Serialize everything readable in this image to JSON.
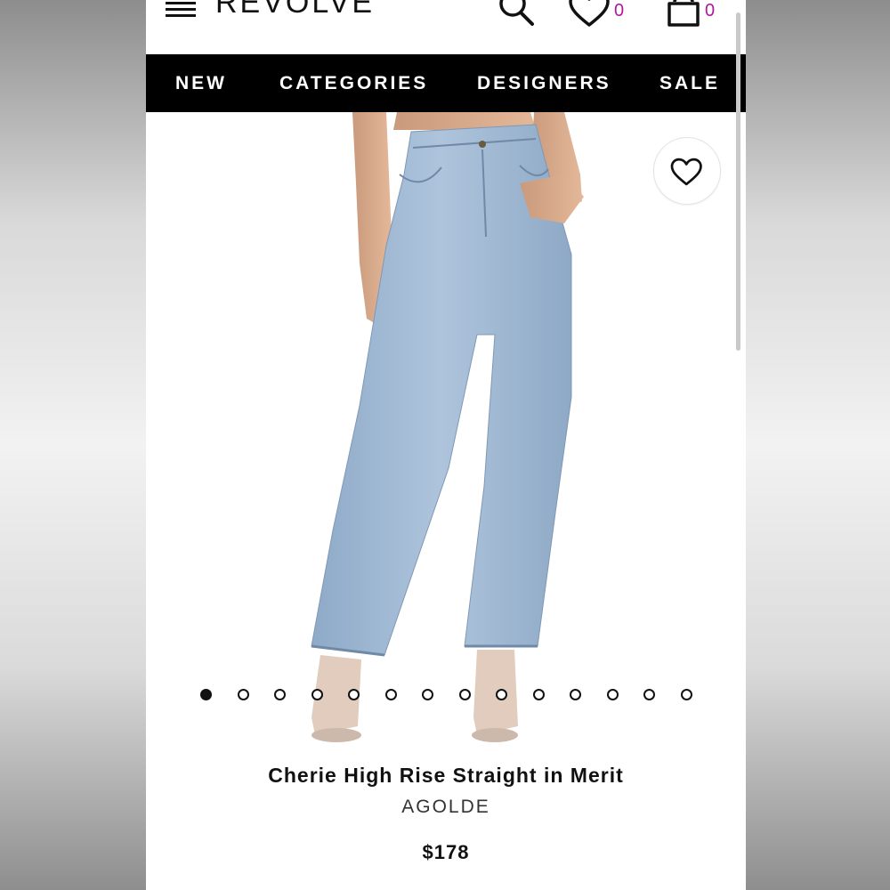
{
  "header": {
    "logo": "REVOLVE",
    "wishlist_count": "0",
    "bag_count": "0"
  },
  "nav": {
    "items": [
      "NEW",
      "CATEGORIES",
      "DESIGNERS",
      "SALE"
    ]
  },
  "gallery": {
    "total_images": 14,
    "active_index": 0
  },
  "product": {
    "name": "Cherie High Rise Straight in Merit",
    "brand": "AGOLDE",
    "price": "$178"
  },
  "colors": {
    "accent_count": "#b0179c",
    "nav_bg": "#000000",
    "denim": "#9cb6d2"
  },
  "icons": [
    "hamburger-icon",
    "search-icon",
    "heart-icon",
    "shopping-bag-icon",
    "heart-outline-icon"
  ]
}
